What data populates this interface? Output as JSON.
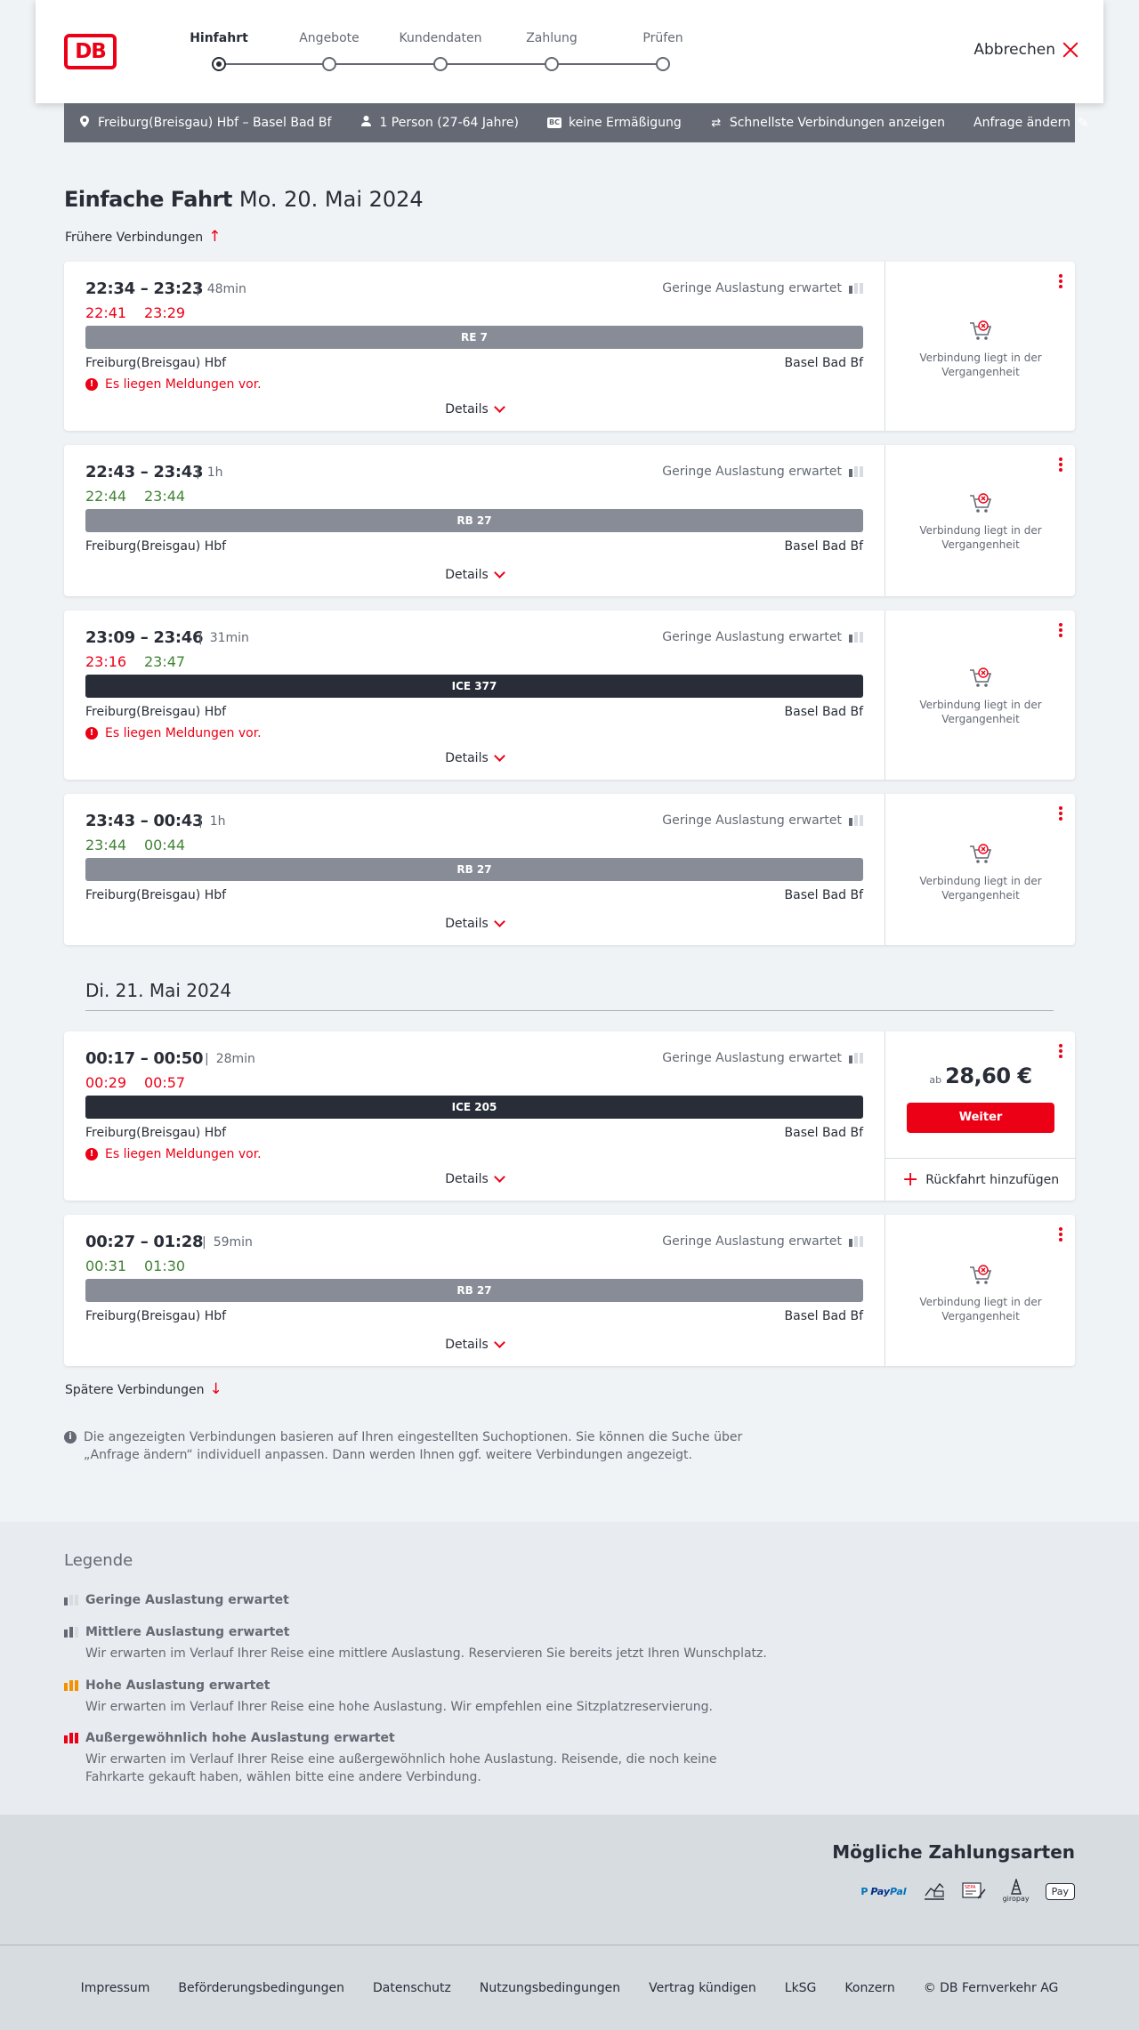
{
  "header": {
    "logo": "DB",
    "steps": [
      {
        "label": "Hinfahrt",
        "active": true
      },
      {
        "label": "Angebote",
        "active": false
      },
      {
        "label": "Kundendaten",
        "active": false
      },
      {
        "label": "Zahlung",
        "active": false
      },
      {
        "label": "Prüfen",
        "active": false
      }
    ],
    "cancel_label": "Abbrechen"
  },
  "query": {
    "route": "Freiburg(Breisgau) Hbf – Basel Bad Bf",
    "passengers": "1 Person (27-64 Jahre)",
    "discount_badge": "BC",
    "discount": "keine Ermäßigung",
    "option": "Schnellste Verbindungen anzeigen",
    "change_label": "Anfrage ändern"
  },
  "title": {
    "main": "Einfache Fahrt",
    "date": "Mo. 20. Mai 2024"
  },
  "earlier_label": "Frühere Verbindungen",
  "later_label": "Spätere Verbindungen",
  "day_separator": "Di. 21. Mai 2024",
  "connections": [
    {
      "times": "22:34 – 23:23",
      "duration": "48min",
      "rt_dep": "22:41",
      "rt_dep_status": "late",
      "rt_arr": "23:29",
      "rt_arr_status": "late",
      "load": "Geringe Auslastung erwartet",
      "train": "RE 7",
      "train_type": "regio",
      "from": "Freiburg(Breisgau) Hbf",
      "to": "Basel Bad Bf",
      "notice": "Es liegen Meldungen vor.",
      "details": "Details",
      "status": "Verbindung liegt in der Vergangenheit"
    },
    {
      "times": "22:43 – 23:43",
      "duration": "1h",
      "rt_dep": "22:44",
      "rt_dep_status": "ontime",
      "rt_arr": "23:44",
      "rt_arr_status": "ontime",
      "load": "Geringe Auslastung erwartet",
      "train": "RB 27",
      "train_type": "regio",
      "from": "Freiburg(Breisgau) Hbf",
      "to": "Basel Bad Bf",
      "notice": "",
      "details": "Details",
      "status": "Verbindung liegt in der Vergangenheit"
    },
    {
      "times": "23:09 – 23:46",
      "duration": "31min",
      "rt_dep": "23:16",
      "rt_dep_status": "late",
      "rt_arr": "23:47",
      "rt_arr_status": "ontime",
      "load": "Geringe Auslastung erwartet",
      "train": "ICE 377",
      "train_type": "ice",
      "from": "Freiburg(Breisgau) Hbf",
      "to": "Basel Bad Bf",
      "notice": "Es liegen Meldungen vor.",
      "details": "Details",
      "status": "Verbindung liegt in der Vergangenheit"
    },
    {
      "times": "23:43 – 00:43",
      "duration": "1h",
      "rt_dep": "23:44",
      "rt_dep_status": "ontime",
      "rt_arr": "00:44",
      "rt_arr_status": "ontime",
      "load": "Geringe Auslastung erwartet",
      "train": "RB 27",
      "train_type": "regio",
      "from": "Freiburg(Breisgau) Hbf",
      "to": "Basel Bad Bf",
      "notice": "",
      "details": "Details",
      "status": "Verbindung liegt in der Vergangenheit"
    },
    {
      "times": "00:17 – 00:50",
      "duration": "28min",
      "rt_dep": "00:29",
      "rt_dep_status": "late",
      "rt_arr": "00:57",
      "rt_arr_status": "late",
      "load": "Geringe Auslastung erwartet",
      "train": "ICE 205",
      "train_type": "ice",
      "from": "Freiburg(Breisgau) Hbf",
      "to": "Basel Bad Bf",
      "notice": "Es liegen Meldungen vor.",
      "details": "Details",
      "price_prefix": "ab",
      "price": "28,60 €",
      "continue_label": "Weiter",
      "return_label": "Rückfahrt hinzufügen"
    },
    {
      "times": "00:27 – 01:28",
      "duration": "59min",
      "rt_dep": "00:31",
      "rt_dep_status": "ontime",
      "rt_arr": "01:30",
      "rt_arr_status": "ontime",
      "load": "Geringe Auslastung erwartet",
      "train": "RB 27",
      "train_type": "regio",
      "from": "Freiburg(Breisgau) Hbf",
      "to": "Basel Bad Bf",
      "notice": "",
      "details": "Details",
      "status": "Verbindung liegt in der Vergangenheit"
    }
  ],
  "info_note": "Die angezeigten Verbindungen basieren auf Ihren eingestellten Suchoptionen. Sie können die Suche über „Anfrage ändern“ individuell anpassen. Dann werden Ihnen ggf. weitere Verbindungen angezeigt.",
  "legend": {
    "title": "Legende",
    "items": [
      {
        "title": "Geringe Auslastung erwartet",
        "desc": ""
      },
      {
        "title": "Mittlere Auslastung erwartet",
        "desc": "Wir erwarten im Verlauf Ihrer Reise eine mittlere Auslastung. Reservieren Sie bereits jetzt Ihren Wunschplatz."
      },
      {
        "title": "Hohe Auslastung erwartet",
        "desc": "Wir erwarten im Verlauf Ihrer Reise eine hohe Auslastung. Wir empfehlen eine Sitzplatzreservierung."
      },
      {
        "title": "Außergewöhnlich hohe Auslastung erwartet",
        "desc": "Wir erwarten im Verlauf Ihrer Reise eine außergewöhnlich hohe Auslastung. Reisende, die noch keine Fahrkarte gekauft haben, wählen bitte eine andere Verbindung."
      }
    ]
  },
  "payment": {
    "title": "Mögliche Zahlungsarten",
    "methods": [
      "PayPal",
      "Kreditkarte",
      "SEPA Lastschrift",
      "giropay",
      "Apple Pay"
    ],
    "labels": {
      "paypal_a": "Pay",
      "paypal_b": "Pal",
      "sepa": "SEPA",
      "giropay": "giropay",
      "applepay": "Pay"
    }
  },
  "footer": {
    "links": [
      "Impressum",
      "Beförderungsbedingungen",
      "Datenschutz",
      "Nutzungsbedingungen",
      "Vertrag kündigen",
      "LkSG",
      "Konzern"
    ],
    "copyright": "© DB Fernverkehr AG"
  },
  "colors": {
    "db_red": "#ec0016",
    "late": "#ec0016",
    "ontime": "#408335",
    "ice_bar": "#282d37",
    "regio_bar": "#878c96"
  },
  "icons": [
    "location-pin-icon",
    "person-icon",
    "bahncard-icon",
    "swap-icon",
    "pencil-icon",
    "arrow-up-icon",
    "arrow-down-icon",
    "cart-icon",
    "alert-icon",
    "chevron-down-icon",
    "kebab-menu-icon",
    "plus-icon",
    "info-icon",
    "load-indicator-icon"
  ]
}
